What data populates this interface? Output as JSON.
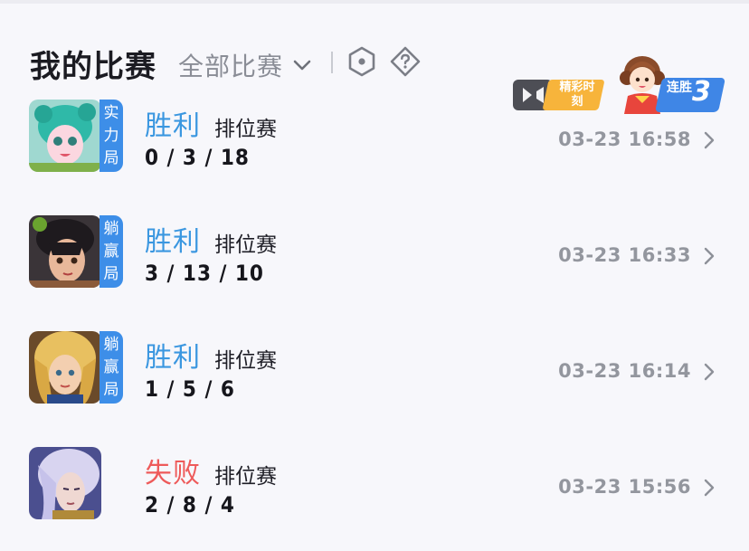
{
  "header": {
    "title": "我的比赛",
    "filter_label": "全部比赛",
    "highlight_label": "精彩时刻",
    "streak_label": "连胜",
    "streak_count": "3"
  },
  "matches": [
    {
      "result": "胜利",
      "outcome": "win",
      "mode": "排位赛",
      "kda": "0 / 3 / 18",
      "time": "03-23 16:58",
      "tag": "实力局",
      "hero_color": "#2fb9a8"
    },
    {
      "result": "胜利",
      "outcome": "win",
      "mode": "排位赛",
      "kda": "3 / 13 / 10",
      "time": "03-23 16:33",
      "tag": "躺赢局",
      "hero_color": "#2e2a30"
    },
    {
      "result": "胜利",
      "outcome": "win",
      "mode": "排位赛",
      "kda": "1 / 5 / 6",
      "time": "03-23 16:14",
      "tag": "躺赢局",
      "hero_color": "#c98a3a"
    },
    {
      "result": "失败",
      "outcome": "loss",
      "mode": "排位赛",
      "kda": "2 / 8 / 4",
      "time": "03-23 15:56",
      "tag": "",
      "hero_color": "#5b5ea6"
    }
  ],
  "colors": {
    "win": "#3b97e0",
    "loss": "#ee5a5a",
    "tag": "#3d8ee8",
    "highlight": "#f7b43b",
    "streak": "#3f86e6"
  }
}
